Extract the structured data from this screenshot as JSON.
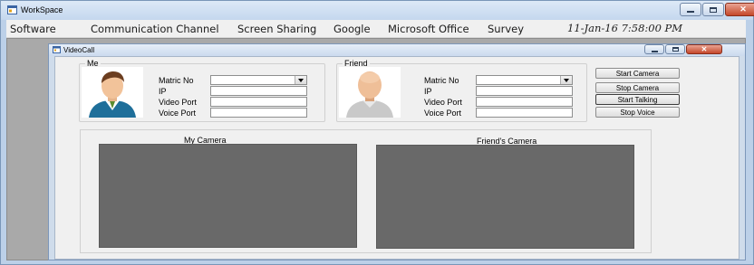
{
  "outer_window": {
    "title": "WorkSpace",
    "controls": [
      "minimize",
      "maximize",
      "close"
    ]
  },
  "menubar": {
    "items": [
      "Software",
      "Communication Channel",
      "Screen Sharing",
      "Google",
      "Microsoft Office",
      "Survey"
    ],
    "clock": "11-Jan-16 7:58:00 PM"
  },
  "inner_window": {
    "title": "VideoCall",
    "controls": [
      "minimize",
      "maximize",
      "close"
    ]
  },
  "me": {
    "legend": "Me",
    "labels": [
      "Matric No",
      "IP",
      "Video Port",
      "Voice Port"
    ],
    "matric_value": "",
    "ip_value": "",
    "video_port_value": "",
    "voice_port_value": ""
  },
  "friend": {
    "legend": "Friend",
    "labels": [
      "Matric No",
      "IP",
      "Video Port",
      "Voice Port"
    ],
    "matric_value": "",
    "ip_value": "",
    "video_port_value": "",
    "voice_port_value": ""
  },
  "buttons": {
    "start_camera": "Start Camera",
    "stop_camera": "Stop Camera",
    "start_talking": "Start Talking",
    "stop_voice": "Stop Voice"
  },
  "cameras": {
    "my_label": "My Camera",
    "friend_label": "Friend's Camera"
  },
  "icons": {
    "app_icon": "window-app-icon",
    "combo_arrow": "dropdown-arrow-icon"
  },
  "colors": {
    "camera_fill": "#696969",
    "titlebar": "#cbdaee",
    "close_button": "#c5472a"
  }
}
